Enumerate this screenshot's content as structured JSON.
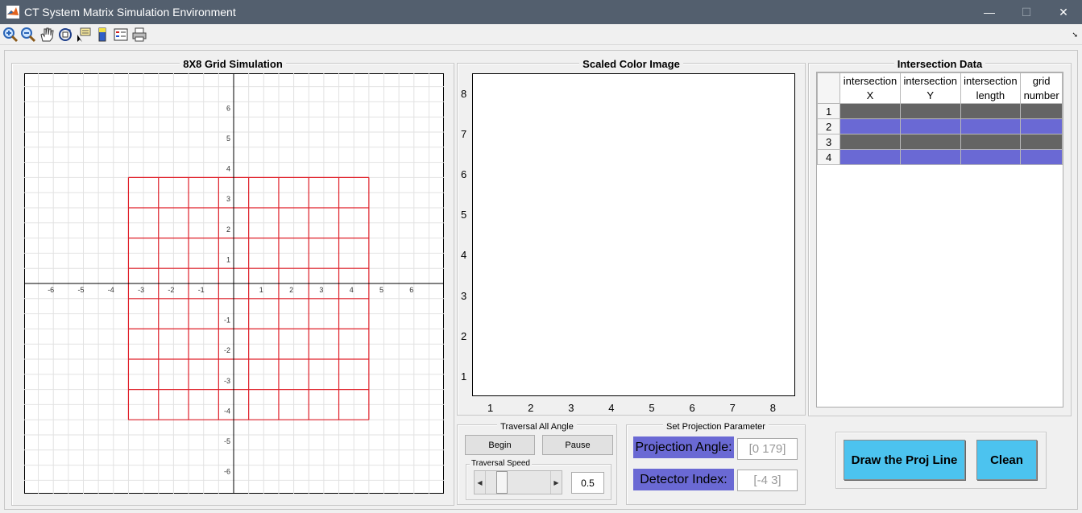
{
  "window": {
    "title": "CT System Matrix Simulation Environment",
    "min": "—",
    "max": "☐",
    "close": "✕"
  },
  "toolbar": {
    "icons": [
      "zoom-in-icon",
      "zoom-out-icon",
      "pan-icon",
      "rotate-icon",
      "data-cursor-icon",
      "colorbar-icon",
      "legend-icon",
      "print-icon"
    ],
    "collapse": "➘"
  },
  "grid_panel": {
    "title": "8X8 Grid Simulation",
    "x_ticks": [
      "-6",
      "-5",
      "-4",
      "-3",
      "-2",
      "-1",
      "1",
      "2",
      "3",
      "4",
      "5",
      "6"
    ],
    "y_ticks": [
      "6",
      "5",
      "4",
      "3",
      "2",
      "1",
      "-1",
      "-2",
      "-3",
      "-4",
      "-5",
      "-6"
    ],
    "grid_color": "#e0202a"
  },
  "image_panel": {
    "title": "Scaled Color Image",
    "x_ticks": [
      "1",
      "2",
      "3",
      "4",
      "5",
      "6",
      "7",
      "8"
    ],
    "y_ticks": [
      "8",
      "7",
      "6",
      "5",
      "4",
      "3",
      "2",
      "1"
    ]
  },
  "traversal": {
    "title": "Traversal All Angle",
    "begin": "Begin",
    "pause": "Pause",
    "speed_title": "Traversal Speed",
    "speed_value": "0.5",
    "slider_fraction": 0.2
  },
  "projection": {
    "title": "Set Projection Parameter",
    "angle_label": "Projection Angle:",
    "angle_placeholder": "[0 179]",
    "detector_label": "Detector Index:",
    "detector_placeholder": "[-4 3]"
  },
  "intersection": {
    "title": "Intersection Data",
    "headers": [
      "intersection X",
      "intersection Y",
      "intersection length",
      "grid number"
    ],
    "rows": [
      "1",
      "2",
      "3",
      "4"
    ],
    "row_colors": [
      "#646464",
      "#6a69d4",
      "#646464",
      "#6a69d4"
    ]
  },
  "actions": {
    "draw": "Draw the Proj Line",
    "clean": "Clean"
  }
}
